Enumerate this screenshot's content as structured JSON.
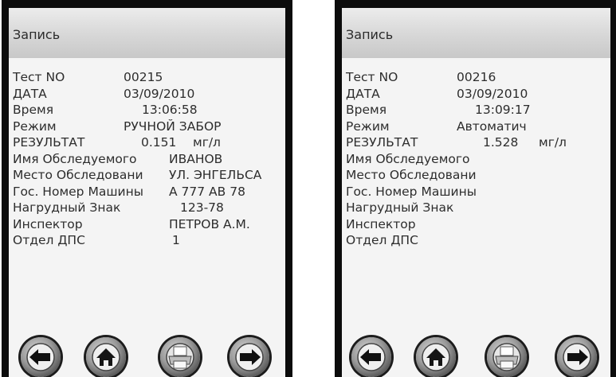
{
  "left": {
    "title": "Запись",
    "rows": {
      "test": {
        "label": "Тест NO",
        "value": "00215"
      },
      "date": {
        "label": "ДАТА",
        "value": "03/09/2010"
      },
      "time": {
        "label": "Время",
        "value": "13:06:58"
      },
      "mode": {
        "label": "Режим",
        "value": "РУЧНОЙ ЗАБОР"
      },
      "result": {
        "label": "РЕЗУЛЬТАТ",
        "value": "0.151",
        "unit": "мг/л"
      },
      "name": {
        "label": "Имя Обследуемого",
        "value": "ИВАНОВ"
      },
      "place": {
        "label": "Место Обследовани",
        "value": "УЛ. ЭНГЕЛЬСА"
      },
      "car": {
        "label": "Гос. Номер Машины",
        "value": "А 777 АВ 78"
      },
      "badge": {
        "label": "Нагрудный Знак",
        "value": "123-78"
      },
      "inspector": {
        "label": "Инспектор",
        "value": "ПЕТРОВ А.М."
      },
      "dept": {
        "label": "Отдел ДПС",
        "value": "1"
      }
    }
  },
  "right": {
    "title": "Запись",
    "rows": {
      "test": {
        "label": "Тест NO",
        "value": "00216"
      },
      "date": {
        "label": "ДАТА",
        "value": "03/09/2010"
      },
      "time": {
        "label": "Время",
        "value": "13:09:17"
      },
      "mode": {
        "label": "Режим",
        "value": "Автоматич"
      },
      "result": {
        "label": "РЕЗУЛЬТАТ",
        "value": "1.528",
        "unit": "мг/л"
      },
      "name": {
        "label": "Имя Обследуемого"
      },
      "place": {
        "label": "Место Обследовани"
      },
      "car": {
        "label": "Гос. Номер Машины"
      },
      "badge": {
        "label": "Нагрудный Знак"
      },
      "inspector": {
        "label": "Инспектор"
      },
      "dept": {
        "label": "Отдел ДПС"
      }
    }
  },
  "buttons": {
    "back": "arrow-left-icon",
    "home": "home-icon",
    "print": "printer-icon",
    "next": "arrow-right-icon"
  }
}
